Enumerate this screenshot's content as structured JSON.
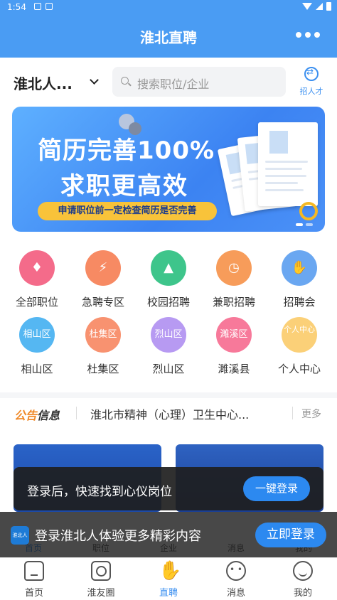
{
  "status": {
    "time": "1:54"
  },
  "header": {
    "title": "淮北直聘"
  },
  "search": {
    "city": "淮北人...",
    "placeholder": "搜索职位/企业",
    "recruit_label": "招人才"
  },
  "banner": {
    "headline_1": "简历完善100%",
    "headline_2": "求职更高效",
    "tip": "申请职位前一定检查简历是否完善"
  },
  "grid": [
    {
      "label": "全部职位",
      "icon": "tie-icon",
      "color": "#f46b8a",
      "text": ""
    },
    {
      "label": "急聘专区",
      "icon": "bag-icon",
      "color": "#f78a63",
      "text": ""
    },
    {
      "label": "校园招聘",
      "icon": "graduation-cap-icon",
      "color": "#3ec58b",
      "text": ""
    },
    {
      "label": "兼职招聘",
      "icon": "clock-icon",
      "color": "#f79c5a",
      "text": ""
    },
    {
      "label": "招聘会",
      "icon": "handshake-icon",
      "color": "#6aa7f1",
      "text": ""
    },
    {
      "label": "相山区",
      "icon": "district-icon",
      "color": "#55b7f2",
      "text": "相山区"
    },
    {
      "label": "杜集区",
      "icon": "district-icon",
      "color": "#f89270",
      "text": "杜集区"
    },
    {
      "label": "烈山区",
      "icon": "district-icon",
      "color": "#b79af2",
      "text": "烈山区"
    },
    {
      "label": "濉溪县",
      "icon": "district-icon",
      "color": "#f7799a",
      "text": "濉溪区"
    },
    {
      "label": "个人中心",
      "icon": "person-icon",
      "color": "#fbd078",
      "text": "个人中心"
    }
  ],
  "notice": {
    "tag_a": "公告",
    "tag_b": "信息",
    "text": "淮北市精神（心理）卫生中心...",
    "more": "更多"
  },
  "toast": {
    "message": "登录后，快速找到心仪岗位",
    "button": "一键登录"
  },
  "ghost_nav": [
    "首页",
    "职位",
    "企业",
    "消息",
    "我的"
  ],
  "login_bar": {
    "logo": "淮北人",
    "message": "登录淮北人体验更多精彩内容",
    "button": "立即登录"
  },
  "tabs": [
    {
      "label": "首页",
      "icon": "home-icon"
    },
    {
      "label": "淮友圈",
      "icon": "community-icon"
    },
    {
      "label": "直聘",
      "icon": "handshake-icon",
      "active": true
    },
    {
      "label": "消息",
      "icon": "message-icon"
    },
    {
      "label": "我的",
      "icon": "profile-icon"
    }
  ]
}
